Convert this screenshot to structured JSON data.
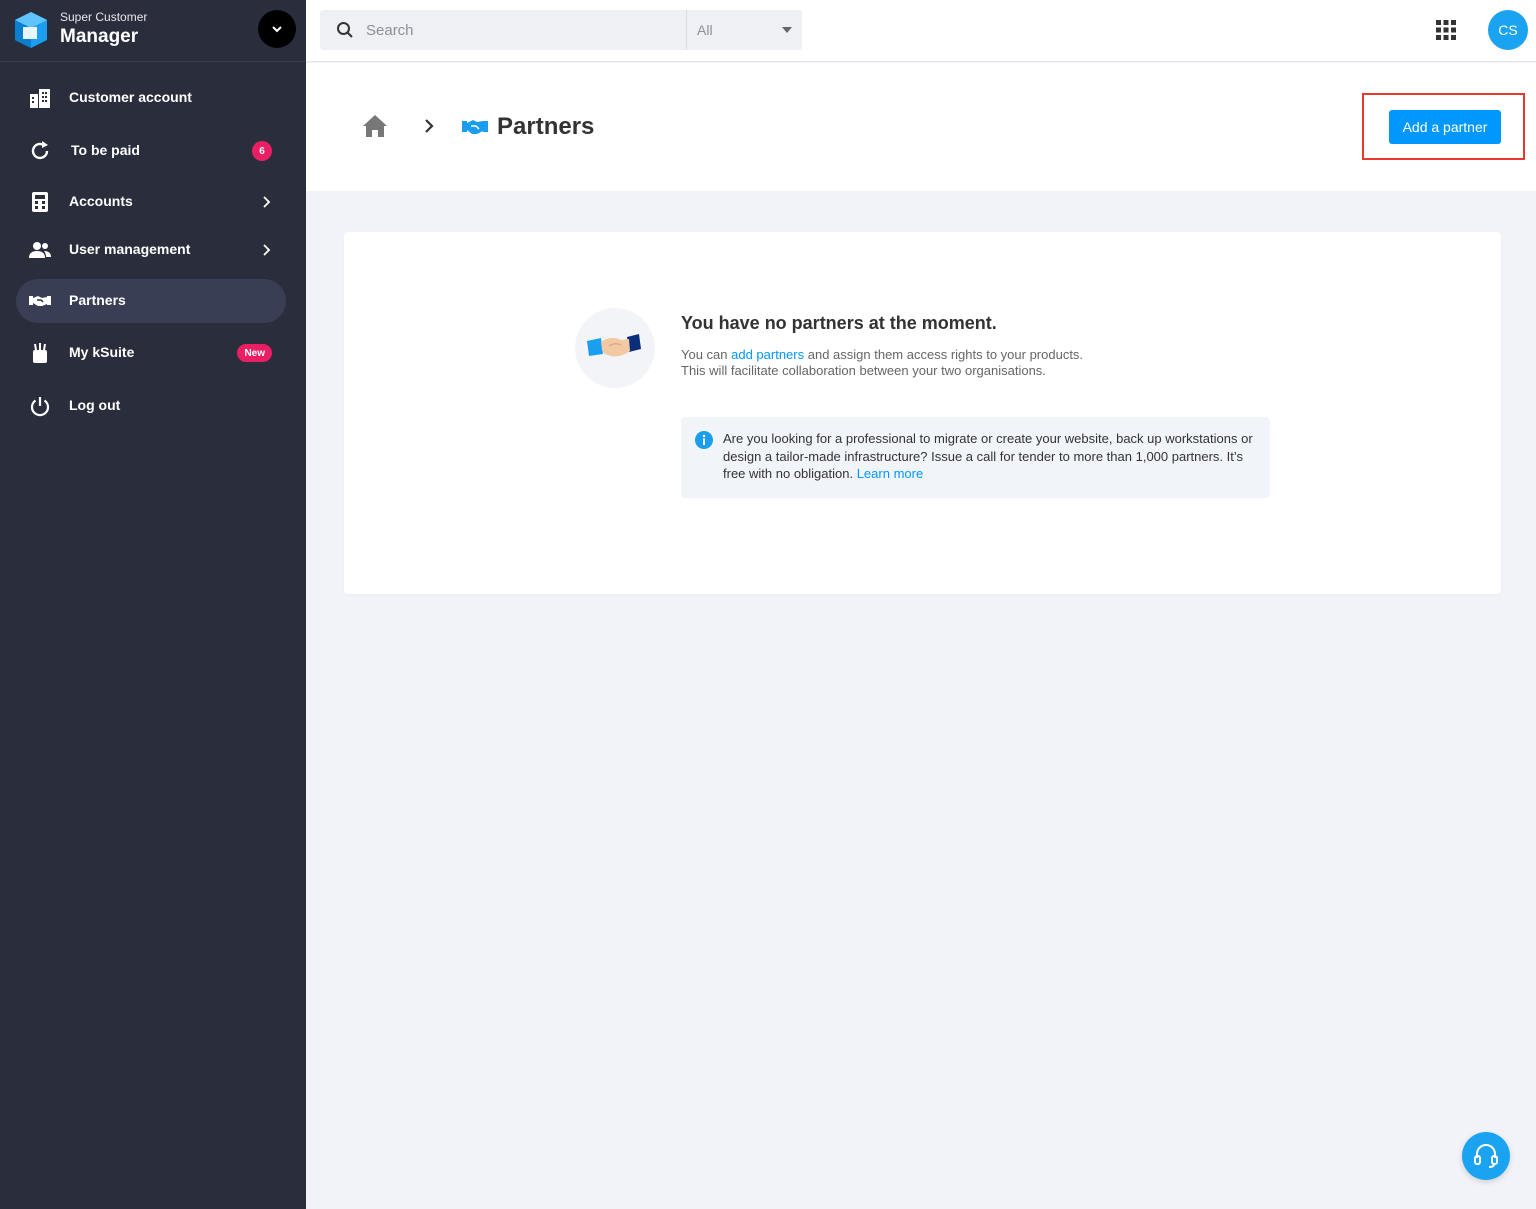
{
  "brand": {
    "subtitle": "Super Customer",
    "title": "Manager"
  },
  "sidebar": {
    "items": [
      {
        "label": "Customer account",
        "icon": "building-icon"
      },
      {
        "label": "To be paid",
        "icon": "refresh-icon",
        "badge": "6"
      },
      {
        "label": "Accounts",
        "icon": "calculator-icon"
      },
      {
        "label": "User management",
        "icon": "users-icon"
      },
      {
        "label": "Partners",
        "icon": "handshake-icon",
        "active": true
      },
      {
        "label": "My kSuite",
        "icon": "ksuite-icon",
        "badge": "New"
      },
      {
        "label": "Log out",
        "icon": "power-icon"
      }
    ]
  },
  "topbar": {
    "search_placeholder": "Search",
    "filter_value": "All",
    "avatar_initials": "CS"
  },
  "breadcrumb": {
    "page_title": "Partners"
  },
  "header": {
    "add_button_label": "Add a partner"
  },
  "empty_state": {
    "title": "You have no partners at the moment.",
    "desc_prefix": "You can ",
    "desc_link": "add partners",
    "desc_suffix": " and assign them access rights to your products.",
    "desc_line2": "This will facilitate collaboration between your two organisations."
  },
  "info": {
    "text": "Are you looking for a professional to migrate or create your website, back up workstations or design a tailor-made infrastructure? Issue a call for tender to more than 1,000 partners. It’s free with no obligation. ",
    "link": "Learn more"
  },
  "colors": {
    "accent": "#0098ff",
    "sidebar_bg": "#2a2d3c",
    "badge": "#e91e63",
    "highlight": "#e8392e"
  }
}
